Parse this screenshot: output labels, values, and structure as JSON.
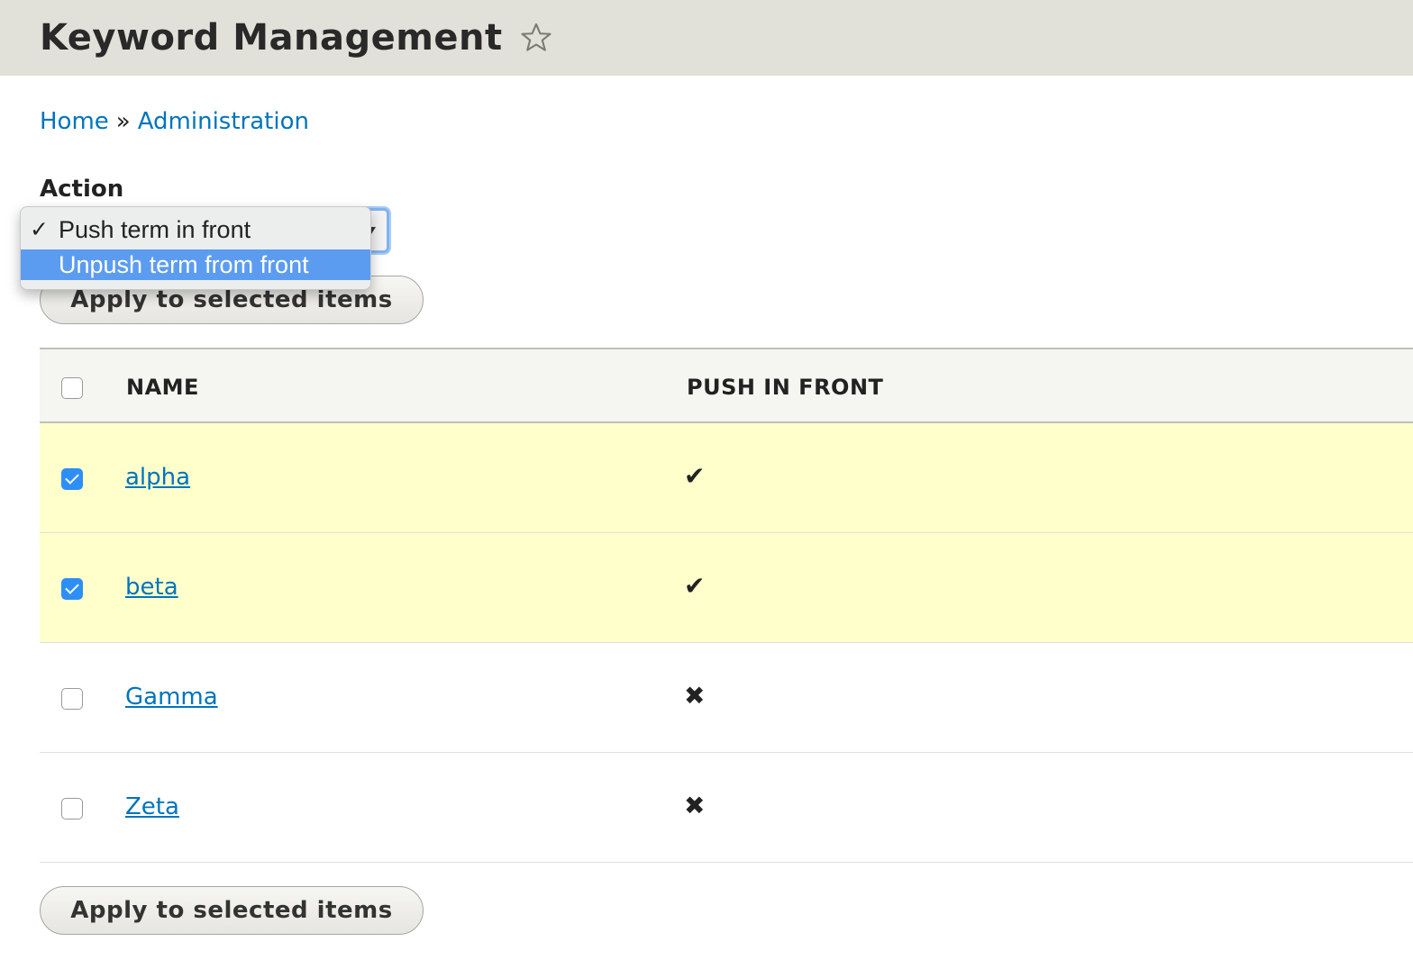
{
  "header": {
    "title": "Keyword Management",
    "star_icon": "star-outline-icon"
  },
  "breadcrumb": {
    "items": [
      "Home",
      "Administration"
    ],
    "separator": "»"
  },
  "action": {
    "label": "Action",
    "selected": "Push term in front",
    "options": [
      {
        "label": "Push term in front",
        "checked": true,
        "highlighted": false
      },
      {
        "label": "Unpush term from front",
        "checked": false,
        "highlighted": true
      }
    ]
  },
  "apply_button_label": "Apply to selected items",
  "table": {
    "columns": [
      "NAME",
      "PUSH IN FRONT"
    ],
    "rows": [
      {
        "name": "alpha",
        "push": "✔",
        "selected": true
      },
      {
        "name": "beta",
        "push": "✔",
        "selected": true
      },
      {
        "name": "Gamma",
        "push": "✖",
        "selected": false
      },
      {
        "name": "Zeta",
        "push": "✖",
        "selected": false
      }
    ]
  },
  "colors": {
    "header_bg": "#e1e0d9",
    "link": "#0074bd",
    "selected_row": "#ffffcc",
    "highlight": "#5c9cf0",
    "checkbox": "#2d8ff5"
  }
}
